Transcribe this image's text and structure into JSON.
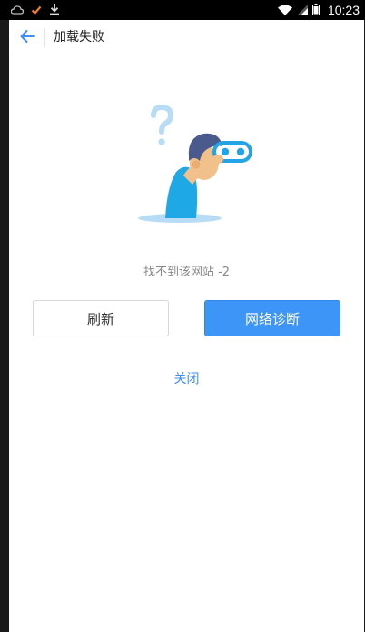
{
  "status_bar": {
    "time": "10:23",
    "left_icons": [
      "cloud-icon",
      "check-icon",
      "download-icon"
    ],
    "right_icons": [
      "wifi-icon",
      "signal-icon",
      "battery-icon"
    ]
  },
  "appbar": {
    "back_icon": "arrow-left-icon",
    "title": "加载失败"
  },
  "error": {
    "message": "找不到该网站 -2"
  },
  "actions": {
    "refresh_label": "刷新",
    "diagnose_label": "网络诊断",
    "close_label": "关闭"
  },
  "colors": {
    "accent": "#3d95f7",
    "link": "#3d8ff0",
    "status_bar": "#000000"
  }
}
